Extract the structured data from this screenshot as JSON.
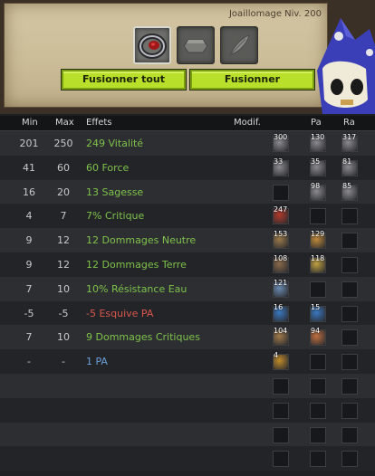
{
  "header": {
    "job_level": "Joaillomage Niv. 200"
  },
  "slots": [
    {
      "icon": "ring-icon"
    },
    {
      "icon": "rune-stone-icon"
    },
    {
      "icon": "feather-icon"
    }
  ],
  "buttons": {
    "merge_all": "Fusionner tout",
    "merge": "Fusionner"
  },
  "columns": {
    "min": "Min",
    "max": "Max",
    "effects": "Effets",
    "modif": "Modif.",
    "pa": "Pa",
    "ra": "Ra"
  },
  "colors": {
    "positive": "#7fc24a",
    "negative": "#d9574c",
    "special": "#6c9fd8",
    "button": "#b8e02a"
  },
  "rows": [
    {
      "min": "201",
      "max": "250",
      "effect": "249 Vitalité",
      "tone": "green",
      "mod": "300",
      "pa": "130",
      "ra": "317"
    },
    {
      "min": "41",
      "max": "60",
      "effect": "60 Force",
      "tone": "green",
      "mod": "33",
      "pa": "35",
      "ra": "81"
    },
    {
      "min": "16",
      "max": "20",
      "effect": "13 Sagesse",
      "tone": "green",
      "mod": "",
      "pa": "98",
      "ra": "85"
    },
    {
      "min": "4",
      "max": "7",
      "effect": "7% Critique",
      "tone": "green",
      "mod": "247",
      "pa": "",
      "ra": ""
    },
    {
      "min": "9",
      "max": "12",
      "effect": "12 Dommages Neutre",
      "tone": "green",
      "mod": "153",
      "pa": "129",
      "ra": ""
    },
    {
      "min": "9",
      "max": "12",
      "effect": "12 Dommages Terre",
      "tone": "green",
      "mod": "108",
      "pa": "118",
      "ra": ""
    },
    {
      "min": "7",
      "max": "10",
      "effect": "10% Résistance Eau",
      "tone": "green",
      "mod": "121",
      "pa": "",
      "ra": ""
    },
    {
      "min": "-5",
      "max": "-5",
      "effect": "-5 Esquive PA",
      "tone": "red",
      "mod": "16",
      "pa": "15",
      "ra": ""
    },
    {
      "min": "7",
      "max": "10",
      "effect": "9 Dommages Critiques",
      "tone": "green",
      "mod": "104",
      "pa": "94",
      "ra": ""
    },
    {
      "min": "-",
      "max": "-",
      "effect": "1 PA",
      "tone": "blue",
      "mod": "4",
      "pa": "",
      "ra": ""
    },
    {
      "min": "",
      "max": "",
      "effect": "",
      "tone": "green",
      "mod": "",
      "pa": "",
      "ra": ""
    },
    {
      "min": "",
      "max": "",
      "effect": "",
      "tone": "green",
      "mod": "",
      "pa": "",
      "ra": ""
    },
    {
      "min": "",
      "max": "",
      "effect": "",
      "tone": "green",
      "mod": "",
      "pa": "",
      "ra": ""
    },
    {
      "min": "",
      "max": "",
      "effect": "",
      "tone": "green",
      "mod": "",
      "pa": "",
      "ra": ""
    }
  ]
}
